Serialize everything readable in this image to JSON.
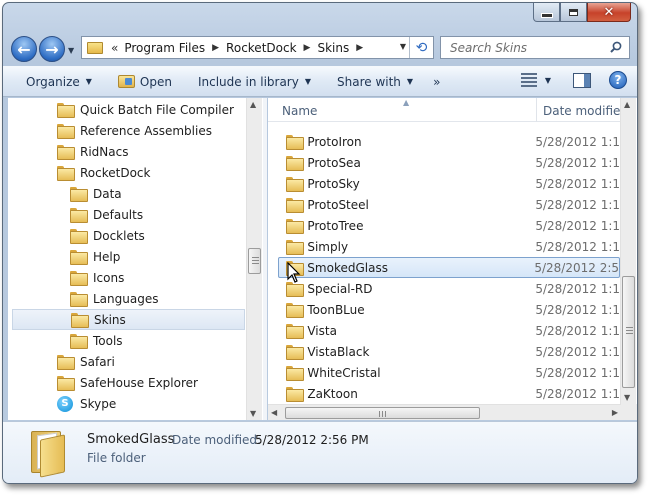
{
  "window": {
    "controls": {
      "minimize": "minimize",
      "maximize": "maximize",
      "close": "close"
    }
  },
  "address": {
    "overflow": "«",
    "crumbs": [
      "Program Files",
      "RocketDock",
      "Skins"
    ]
  },
  "search": {
    "placeholder": "Search Skins"
  },
  "toolbar": {
    "organize": "Organize",
    "open": "Open",
    "include_in_library": "Include in library",
    "share_with": "Share with",
    "more": "»"
  },
  "nav_tree": [
    {
      "label": "Quick Batch File Compiler",
      "level": 0,
      "icon": "folder-icon"
    },
    {
      "label": "Reference Assemblies",
      "level": 0,
      "icon": "folder-icon"
    },
    {
      "label": "RidNacs",
      "level": 0,
      "icon": "folder-icon"
    },
    {
      "label": "RocketDock",
      "level": 0,
      "icon": "folder-icon"
    },
    {
      "label": "Data",
      "level": 1,
      "icon": "folder-icon"
    },
    {
      "label": "Defaults",
      "level": 1,
      "icon": "folder-icon"
    },
    {
      "label": "Docklets",
      "level": 1,
      "icon": "folder-icon"
    },
    {
      "label": "Help",
      "level": 1,
      "icon": "folder-icon"
    },
    {
      "label": "Icons",
      "level": 1,
      "icon": "folder-icon"
    },
    {
      "label": "Languages",
      "level": 1,
      "icon": "folder-icon"
    },
    {
      "label": "Skins",
      "level": 1,
      "icon": "folder-icon",
      "selected": true
    },
    {
      "label": "Tools",
      "level": 1,
      "icon": "folder-icon"
    },
    {
      "label": "Safari",
      "level": 0,
      "icon": "folder-icon"
    },
    {
      "label": "SafeHouse Explorer",
      "level": 0,
      "icon": "folder-icon"
    },
    {
      "label": "Skype",
      "level": 0,
      "icon": "skype-icon"
    }
  ],
  "columns": {
    "name": "Name",
    "date_modified": "Date modifie"
  },
  "files": [
    {
      "name": "ProtoIron",
      "date": "5/28/2012 1:1"
    },
    {
      "name": "ProtoSea",
      "date": "5/28/2012 1:1"
    },
    {
      "name": "ProtoSky",
      "date": "5/28/2012 1:1"
    },
    {
      "name": "ProtoSteel",
      "date": "5/28/2012 1:1"
    },
    {
      "name": "ProtoTree",
      "date": "5/28/2012 1:1"
    },
    {
      "name": "Simply",
      "date": "5/28/2012 1:1"
    },
    {
      "name": "SmokedGlass",
      "date": "5/28/2012 2:5",
      "selected": true
    },
    {
      "name": "Special-RD",
      "date": "5/28/2012 1:1"
    },
    {
      "name": "ToonBLue",
      "date": "5/28/2012 1:1"
    },
    {
      "name": "Vista",
      "date": "5/28/2012 1:1"
    },
    {
      "name": "VistaBlack",
      "date": "5/28/2012 1:1"
    },
    {
      "name": "WhiteCristal",
      "date": "5/28/2012 1:1"
    },
    {
      "name": "ZaKtoon",
      "date": "5/28/2012 1:1"
    }
  ],
  "details": {
    "name": "SmokedGlass",
    "date_label": "Date modified:",
    "date_value": "5/28/2012 2:56 PM",
    "type": "File folder"
  },
  "colors": {
    "selection": "#d5e6f8",
    "selection_border": "#7da2ce",
    "folder": "#e6bd56",
    "chrome": "#b9cadf"
  }
}
